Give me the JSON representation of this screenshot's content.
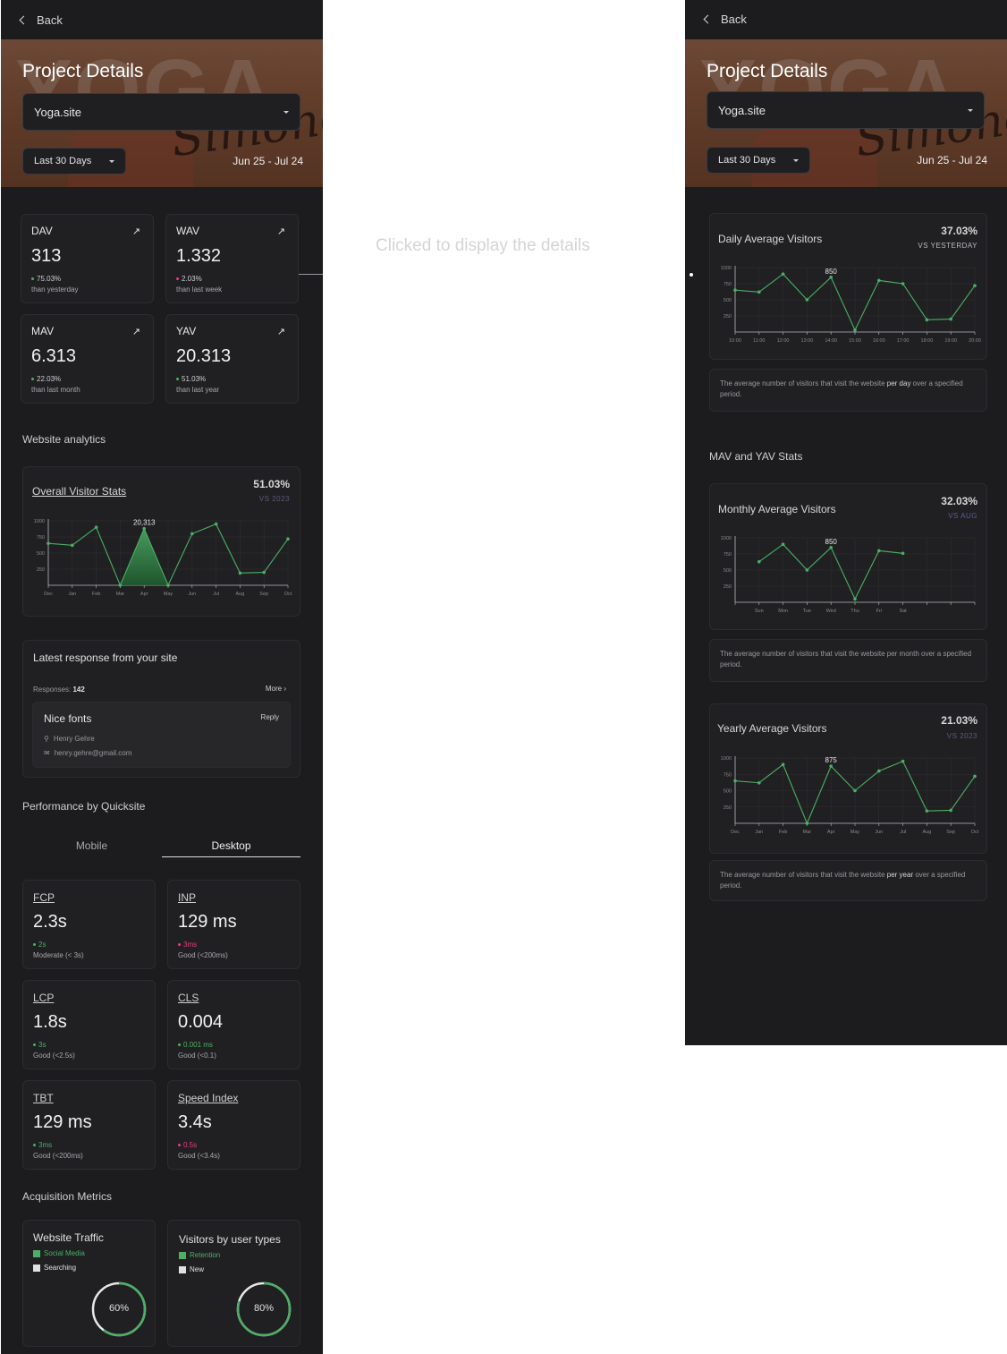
{
  "annotation": "Clicked to display the details",
  "header": {
    "back_label": "Back",
    "title": "Project Details",
    "project": "Yoga.site",
    "range": "Last 30 Days",
    "dates": "Jun 25 - Jul 24",
    "hero_word": "YOGA",
    "hero_script": "Simone"
  },
  "stats": [
    {
      "label": "DAV",
      "value": "313",
      "change": "75.03%",
      "sub": "than yesterday"
    },
    {
      "label": "WAV",
      "value": "1.332",
      "change": "2.03%",
      "sub": "than last week"
    },
    {
      "label": "MAV",
      "value": "6.313",
      "change": "22.03%",
      "sub": "than last month"
    },
    {
      "label": "YAV",
      "value": "20.313",
      "change": "51.03%",
      "sub": "than last year"
    }
  ],
  "analytics": {
    "section": "Website analytics",
    "title": "Overall Visitor Stats",
    "pct": "51.03%",
    "vs": "VS 2023",
    "peak_label": "20,313"
  },
  "responses": {
    "title": "Latest response from your site",
    "count_label": "Responses:",
    "count": "142",
    "more": "More",
    "item_title": "Nice fonts",
    "reply": "Reply",
    "name": "Henry Gehre",
    "email": "henry.gehre@gmail.com"
  },
  "performance": {
    "section": "Performance by Quicksite",
    "tabs": [
      "Mobile",
      "Desktop"
    ],
    "metrics": [
      {
        "label": "FCP",
        "value": "2.3s",
        "change": "2s",
        "sub": "Moderate (< 3s)",
        "color": "#4caf65"
      },
      {
        "label": "INP",
        "value": "129 ms",
        "change": "3ms",
        "sub": "Good (<200ms)",
        "color": "#e0407a"
      },
      {
        "label": "LCP",
        "value": "1.8s",
        "change": "3s",
        "sub": "Good (<2.5s)",
        "color": "#4caf65"
      },
      {
        "label": "CLS",
        "value": "0.004",
        "change": "0.001 ms",
        "sub": "Good (<0.1)",
        "color": "#4caf65"
      },
      {
        "label": "TBT",
        "value": "129 ms",
        "change": "3ms",
        "sub": "Good (<200ms)",
        "color": "#4caf65"
      },
      {
        "label": "Speed Index",
        "value": "3.4s",
        "change": "0.5s",
        "sub": "Good (<3.4s)",
        "color": "#e0407a"
      }
    ]
  },
  "acquisition": {
    "section": "Acquisition Metrics",
    "traffic_title": "Website Traffic",
    "traffic_legend": [
      "Social Media",
      "Searching"
    ],
    "traffic_pct": "60%",
    "traffic_value": 0.6,
    "visitors_title": "Visitors by user types",
    "visitors_legend": [
      "Retention",
      "New"
    ],
    "visitors_pct": "80%",
    "visitors_value": 0.8
  },
  "detail": {
    "daily_title": "Daily Average Visitors",
    "daily_pct": "37.03%",
    "daily_vs": "VS YESTERDAY",
    "daily_peak": "850",
    "daily_desc_pre": "The average number of visitors that visit the website ",
    "daily_desc_bold": "per day",
    "daily_desc_post": " over a specified period.",
    "mav_section": "MAV and YAV Stats",
    "monthly_title": "Monthly Average Visitors",
    "monthly_pct": "32.03%",
    "monthly_vs": "VS AUG",
    "monthly_peak": "850",
    "monthly_desc": "The average number of visitors that visit the website per month over a specified period.",
    "yearly_title": "Yearly Average Visitors",
    "yearly_pct": "21.03%",
    "yearly_vs": "VS 2023",
    "yearly_peak": "875",
    "yearly_desc_pre": "The average number of visitors that visit the website ",
    "yearly_desc_bold": "per year",
    "yearly_desc_post": " over a specified period."
  },
  "colors": {
    "accent": "#4caf65",
    "negative": "#e0407a",
    "muted_purple": "#5a5a9a"
  },
  "chart_data": [
    {
      "type": "area",
      "title": "Overall Visitor Stats",
      "categories": [
        "Dec",
        "Jan",
        "Feb",
        "Mar",
        "Apr",
        "May",
        "Jun",
        "Jul",
        "Aug",
        "Sep",
        "Oct"
      ],
      "values": [
        650,
        620,
        900,
        0,
        880,
        0,
        800,
        950,
        190,
        200,
        720
      ],
      "yticks": [
        250,
        500,
        750,
        1000
      ],
      "ylim": [
        0,
        1000
      ],
      "highlight": "Apr"
    },
    {
      "type": "line",
      "title": "Daily Average Visitors",
      "categories": [
        "10:00",
        "11:00",
        "12:00",
        "13:00",
        "14:00",
        "15:00",
        "16:00",
        "17:00",
        "18:00",
        "19:00",
        "20:00"
      ],
      "values": [
        650,
        620,
        900,
        500,
        850,
        30,
        800,
        750,
        190,
        200,
        720
      ],
      "yticks": [
        250,
        500,
        750,
        1000
      ],
      "ylim": [
        0,
        1000
      ]
    },
    {
      "type": "line",
      "title": "Monthly Average Visitors",
      "categories": [
        "Sun",
        "Mon",
        "Tue",
        "Wed",
        "Thu",
        "Fri",
        "Sat"
      ],
      "values": [
        630,
        900,
        500,
        850,
        50,
        800,
        760
      ],
      "yticks": [
        250,
        500,
        750,
        1000
      ],
      "ylim": [
        0,
        1000
      ]
    },
    {
      "type": "line",
      "title": "Yearly Average Visitors",
      "categories": [
        "Dec",
        "Jan",
        "Feb",
        "Mar",
        "Apr",
        "May",
        "Jun",
        "Jul",
        "Aug",
        "Sep",
        "Oct"
      ],
      "values": [
        650,
        620,
        900,
        0,
        875,
        500,
        800,
        950,
        190,
        200,
        720
      ],
      "yticks": [
        250,
        500,
        750,
        1000
      ],
      "ylim": [
        0,
        1000
      ]
    }
  ]
}
